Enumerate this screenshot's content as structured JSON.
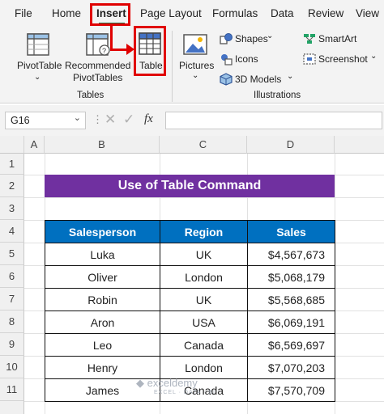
{
  "menu": {
    "items": [
      "File",
      "Home",
      "Insert",
      "Page Layout",
      "Formulas",
      "Data",
      "Review",
      "View"
    ],
    "active": "Insert"
  },
  "ribbon": {
    "tables_group": {
      "label": "Tables",
      "pivot_table": "PivotTable",
      "recommended_line1": "Recommended",
      "recommended_line2": "PivotTables",
      "table": "Table"
    },
    "illustrations_group": {
      "label": "Illustrations",
      "pictures": "Pictures",
      "shapes": "Shapes",
      "icons": "Icons",
      "models": "3D Models",
      "smartart": "SmartArt",
      "screenshot": "Screenshot"
    }
  },
  "formula_bar": {
    "name_box": "G16",
    "fx": "fx",
    "value": ""
  },
  "grid": {
    "columns": [
      "A",
      "B",
      "C",
      "D"
    ],
    "rows": [
      "1",
      "2",
      "3",
      "4",
      "5",
      "6",
      "7",
      "8",
      "9",
      "10",
      "11"
    ]
  },
  "sheet": {
    "title": "Use of Table Command",
    "headers": [
      "Salesperson",
      "Region",
      "Sales"
    ],
    "rows": [
      [
        "Luka",
        "UK",
        "$4,567,673"
      ],
      [
        "Oliver",
        "London",
        "$5,068,179"
      ],
      [
        "Robin",
        "UK",
        "$5,568,685"
      ],
      [
        "Aron",
        "USA",
        "$6,069,191"
      ],
      [
        "Leo",
        "Canada",
        "$6,569,697"
      ],
      [
        "Henry",
        "London",
        "$7,070,203"
      ],
      [
        "James",
        "Canada",
        "$7,570,709"
      ]
    ]
  },
  "watermark": {
    "name": "exceldemy",
    "tagline": "EXCEL · DATA · BI"
  },
  "colors": {
    "title_fill": "#7030a0",
    "header_fill": "#0070c0",
    "highlight": "#e00000",
    "accent": "#217346"
  }
}
